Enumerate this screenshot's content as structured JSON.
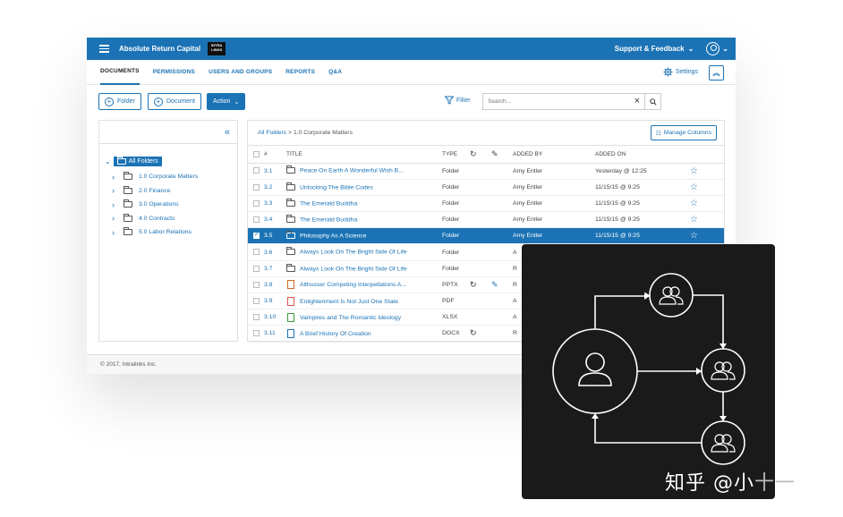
{
  "header": {
    "company": "Absolute Return Capital",
    "logo_text": "INTRA LINKS",
    "support_label": "Support & Feedback"
  },
  "tabs": [
    "DOCUMENTS",
    "PERMISSIONS",
    "USERS AND GROUPS",
    "REPORTS",
    "Q&A"
  ],
  "settings_label": "Settings",
  "toolbar": {
    "folder_label": "Folder",
    "document_label": "Document",
    "action_label": "Action",
    "filter_label": "Filter",
    "search_placeholder": "Search..."
  },
  "tree": {
    "root": "All Folders",
    "items": [
      "1.0 Corporate Matters",
      "2.0 Finance",
      "3.0 Operations",
      "4.0 Contracts",
      "5.0 Labor Relations"
    ]
  },
  "grid": {
    "breadcrumb_link": "All Folders",
    "breadcrumb_rest": " > 1.0 Corporate Matters",
    "manage_columns_label": "Manage Columns",
    "columns": [
      "#",
      "TITLE",
      "TYPE",
      "ADDED BY",
      "ADDED ON"
    ],
    "rows": [
      {
        "num": "3.1",
        "title": "Peace On Earth A Wonderful Wish B...",
        "type": "Folder",
        "by": "Amy Entler",
        "on": "Yesterday @ 12:25",
        "icon": "folder"
      },
      {
        "num": "3.2",
        "title": "Unlocking The Bible Codes",
        "type": "Folder",
        "by": "Amy Entler",
        "on": "11/15/15 @ 9:25",
        "icon": "folder"
      },
      {
        "num": "3.3",
        "title": "The Emerald Buddha",
        "type": "Folder",
        "by": "Amy Entler",
        "on": "11/15/15 @ 9:25",
        "icon": "folder"
      },
      {
        "num": "3.4",
        "title": "The Emerald Buddha",
        "type": "Folder",
        "by": "Amy Entler",
        "on": "11/15/15 @ 9:25",
        "icon": "folder"
      },
      {
        "num": "3.5",
        "title": "Philosophy As A Science",
        "type": "Folder",
        "by": "Amy Entler",
        "on": "11/15/15 @ 9:25",
        "icon": "folder",
        "selected": true
      },
      {
        "num": "3.6",
        "title": "Always Look On The Bright Side Of Life",
        "type": "Folder",
        "by": "A",
        "on": "",
        "icon": "folder"
      },
      {
        "num": "3.7",
        "title": "Always Look On The Bright Side Of Life",
        "type": "Folder",
        "by": "R",
        "on": "",
        "icon": "folder"
      },
      {
        "num": "3.8",
        "title": "Althusser Competing Interpellations A...",
        "type": "PPTX",
        "by": "R",
        "on": "",
        "icon": "pptx"
      },
      {
        "num": "3.9",
        "title": "Enlightenment Is Not Just One State",
        "type": "PDF",
        "by": "A",
        "on": "",
        "icon": "pdf"
      },
      {
        "num": "3.10",
        "title": "Vampires and The Romantic Ideology",
        "type": "XLSX",
        "by": "A",
        "on": "",
        "icon": "xlsx"
      },
      {
        "num": "3.11",
        "title": "A Brief History Of Creation",
        "type": "DOCX",
        "by": "R",
        "on": "",
        "icon": "docx"
      }
    ]
  },
  "footer": "© 2017, Intralinks Inc.",
  "watermark": {
    "main": "知乎 @小",
    "tail": "十一"
  },
  "colors": {
    "brand": "#1b73b5",
    "panel": "#1a1a1a"
  }
}
